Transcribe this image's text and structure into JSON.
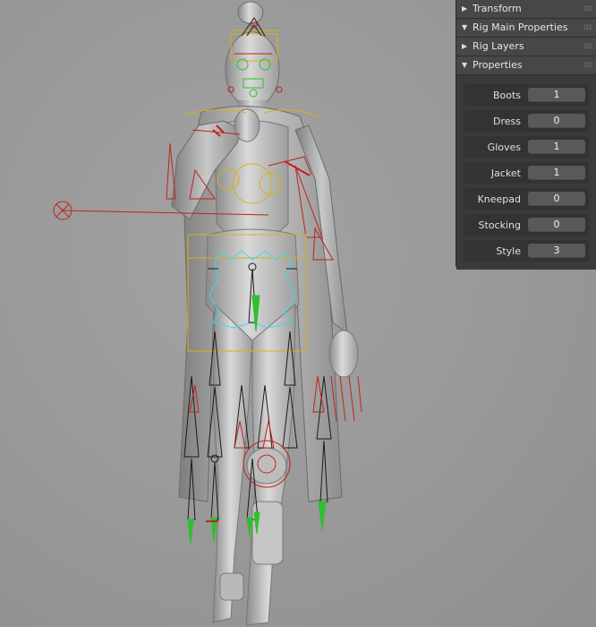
{
  "npanel": {
    "panels": [
      {
        "label": "Transform",
        "expanded": false
      },
      {
        "label": "Rig Main Properties",
        "expanded": true
      },
      {
        "label": "Rig Layers",
        "expanded": false
      },
      {
        "label": "Properties",
        "expanded": true
      }
    ],
    "properties": [
      {
        "label": "Boots",
        "value": "1"
      },
      {
        "label": "Dress",
        "value": "0"
      },
      {
        "label": "Gloves",
        "value": "1"
      },
      {
        "label": "Jacket",
        "value": "1"
      },
      {
        "label": "Kneepad",
        "value": "0"
      },
      {
        "label": "Stocking",
        "value": "0"
      },
      {
        "label": "Style",
        "value": "3"
      }
    ]
  },
  "icons": {
    "collapsed": "triangle-right-icon",
    "expanded": "triangle-down-icon",
    "grip": "drag-grip-icon"
  },
  "colors": {
    "viewport_bg": "#9a9a9a",
    "panel_bg": "#3d3d3d",
    "bone_red": "#c0221e",
    "bone_yellow": "#d7b21a",
    "bone_green": "#2fbf2f",
    "bone_cyan": "#3fd9e6",
    "bone_black": "#1a1a1a"
  }
}
